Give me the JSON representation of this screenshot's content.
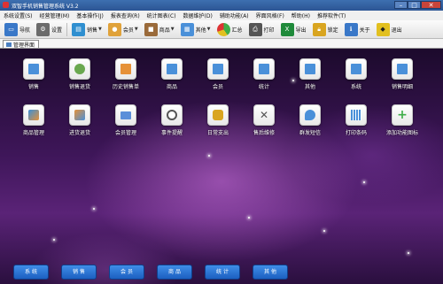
{
  "window": {
    "title": "双智手机销售管理系统 V3.2"
  },
  "menubar": [
    {
      "label": "系统设置(S)"
    },
    {
      "label": "经营管理(M)"
    },
    {
      "label": "基本操作(J)"
    },
    {
      "label": "报表查询(R)"
    },
    {
      "label": "统计图表(C)"
    },
    {
      "label": "数据维护(D)"
    },
    {
      "label": "辅助功能(A)"
    },
    {
      "label": "界面风格(F)"
    },
    {
      "label": "帮助(H)"
    },
    {
      "label": "推荐软件(T)"
    }
  ],
  "toolbar": [
    {
      "label": "导航",
      "icon": "navigate-icon",
      "color": "#3a78c8",
      "dropdown": false
    },
    {
      "label": "设置",
      "icon": "settings-icon",
      "color": "#6b6b6b",
      "dropdown": false
    },
    {
      "label": "销售",
      "icon": "sales-icon",
      "color": "#2f8fd0",
      "dropdown": true
    },
    {
      "label": "会员",
      "icon": "member-icon",
      "color": "#e0a23a",
      "dropdown": true
    },
    {
      "label": "商品",
      "icon": "goods-icon",
      "color": "#9a6a3a",
      "dropdown": true
    },
    {
      "label": "其他",
      "icon": "other-icon",
      "color": "#4a90d9",
      "dropdown": true
    },
    {
      "label": "汇总",
      "icon": "summary-icon",
      "color": "#3fae49",
      "dropdown": false
    },
    {
      "label": "打印",
      "icon": "print-icon",
      "color": "#555555",
      "dropdown": false
    },
    {
      "label": "导出",
      "icon": "excel-export-icon",
      "color": "#1f8a3a",
      "dropdown": false
    },
    {
      "label": "锁定",
      "icon": "lock-icon",
      "color": "#d9a520",
      "dropdown": false
    },
    {
      "label": "关于",
      "icon": "about-icon",
      "color": "#3a78c8",
      "dropdown": false
    },
    {
      "label": "退出",
      "icon": "exit-icon",
      "color": "#e2c020",
      "dropdown": false
    }
  ],
  "tab": {
    "label": "管理界面"
  },
  "tiles_row1": [
    {
      "label": "销售",
      "icon": "sales-window-icon",
      "color": "#4a90d9"
    },
    {
      "label": "销售退货",
      "icon": "sales-return-icon",
      "color": "#6aa84f"
    },
    {
      "label": "历史销售单",
      "icon": "sales-history-icon",
      "color": "#e69138"
    },
    {
      "label": "商品",
      "icon": "goods-window-icon",
      "color": "#4a90d9"
    },
    {
      "label": "会员",
      "icon": "member-window-icon",
      "color": "#4a90d9"
    },
    {
      "label": "统计",
      "icon": "statistics-window-icon",
      "color": "#4a90d9"
    },
    {
      "label": "其他",
      "icon": "other-window-icon",
      "color": "#4a90d9"
    },
    {
      "label": "系统",
      "icon": "system-window-icon",
      "color": "#4a90d9"
    },
    {
      "label": "销售明细",
      "icon": "sales-detail-icon",
      "color": "#4a90d9"
    }
  ],
  "tiles_row2": [
    {
      "label": "商品管理",
      "icon": "goods-management-icon",
      "color": "#3a8fd9"
    },
    {
      "label": "进货退货",
      "icon": "purchase-return-icon",
      "color": "#e69138"
    },
    {
      "label": "会员管理",
      "icon": "member-card-icon",
      "color": "#5b8fd9"
    },
    {
      "label": "事件提醒",
      "icon": "clock-reminder-icon",
      "color": "#555555"
    },
    {
      "label": "日常支出",
      "icon": "coins-icon",
      "color": "#d9a520"
    },
    {
      "label": "售后维修",
      "icon": "tools-icon",
      "color": "#666666"
    },
    {
      "label": "群发短信",
      "icon": "sms-bubble-icon",
      "color": "#4a90d9"
    },
    {
      "label": "打印条码",
      "icon": "barcode-print-icon",
      "color": "#4a90d9"
    },
    {
      "label": "添加功能图标",
      "icon": "add-plus-icon",
      "color": "#3fae49"
    }
  ],
  "bottom_buttons": [
    {
      "label": "系 统"
    },
    {
      "label": "销 售"
    },
    {
      "label": "会 员"
    },
    {
      "label": "商 品"
    },
    {
      "label": "统 计"
    },
    {
      "label": "其 他"
    }
  ]
}
